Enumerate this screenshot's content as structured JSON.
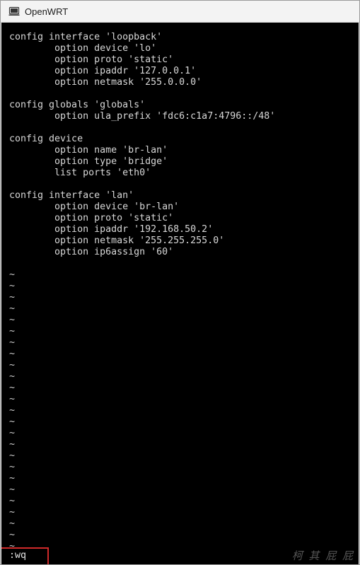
{
  "window": {
    "title": "OpenWRT",
    "icon": "terminal-window-icon"
  },
  "editor": {
    "lines": [
      "config interface 'loopback'",
      "        option device 'lo'",
      "        option proto 'static'",
      "        option ipaddr '127.0.0.1'",
      "        option netmask '255.0.0.0'",
      "",
      "config globals 'globals'",
      "        option ula_prefix 'fdc6:c1a7:4796::/48'",
      "",
      "config device",
      "        option name 'br-lan'",
      "        option type 'bridge'",
      "        list ports 'eth0'",
      "",
      "config interface 'lan'",
      "        option device 'br-lan'",
      "        option proto 'static'",
      "        option ipaddr '192.168.50.2'",
      "        option netmask '255.255.255.0'",
      "        option ip6assign '60'",
      ""
    ],
    "tilde_lines": [
      "~",
      "~",
      "~",
      "~",
      "~",
      "~",
      "~",
      "~",
      "~",
      "~",
      "~",
      "~",
      "~",
      "~",
      "~",
      "~",
      "~",
      "~",
      "~",
      "~",
      "~",
      "~",
      "~",
      "~",
      "~"
    ],
    "command": ":wq"
  },
  "watermark": "柯 其 屁 屁",
  "colors": {
    "terminal_bg": "#000000",
    "terminal_fg": "#d8d8d8",
    "highlight": "#d02a2a"
  }
}
